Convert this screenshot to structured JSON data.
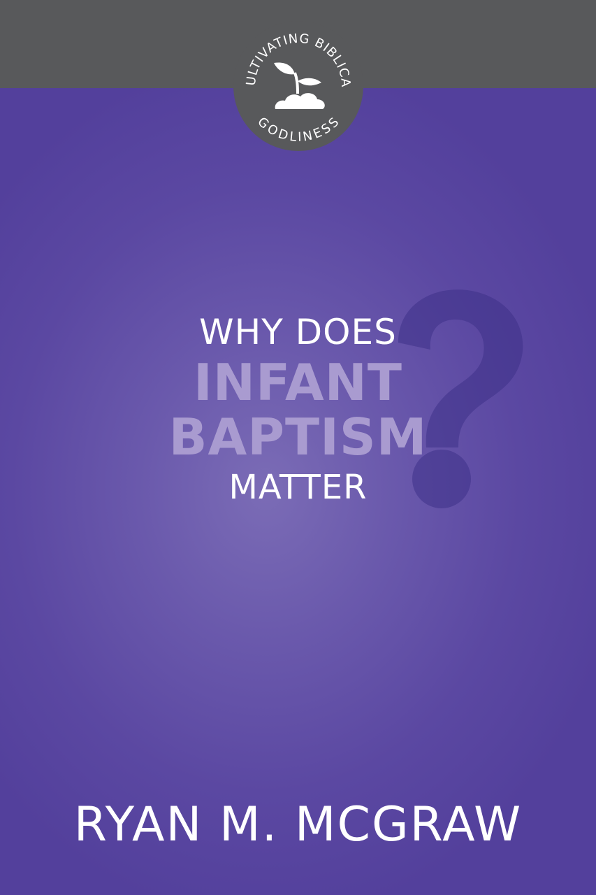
{
  "series": {
    "arc_top": "CULTIVATING BIBLICAL",
    "arc_bottom": "GODLINESS",
    "band_color": "#58595b",
    "badge_color": "#58595b"
  },
  "title": {
    "line1": "WHY DOES",
    "line2": "INFANT",
    "line3": "BAPTISM",
    "line4": "MATTER"
  },
  "author": "RYAN M. MCGRAW",
  "colors": {
    "background": "#5b48a2",
    "title_highlight": "#a99bd0",
    "text": "#ffffff"
  },
  "icons": {
    "series_logo": "sprout-over-clouds-icon",
    "decoration": "question-mark-icon"
  }
}
